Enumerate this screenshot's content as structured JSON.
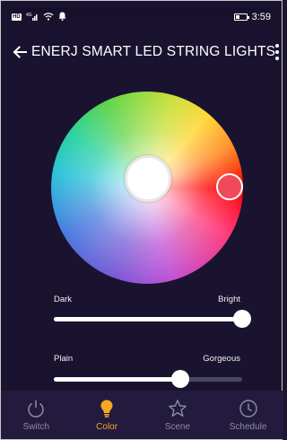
{
  "status_bar": {
    "hd_label": "HD",
    "signal_label": "4G",
    "time": "3:59",
    "battery_level_fraction": 0.35
  },
  "app_bar": {
    "title": "ENERJ SMART LED STRING LIGHTS",
    "back_icon": "arrow-left-icon",
    "menu_icon": "more-vert-icon"
  },
  "color_wheel": {
    "center_color": "#ffffff",
    "selected_color": "#ef4a5c"
  },
  "sliders": {
    "brightness": {
      "left_label": "Dark",
      "right_label": "Bright",
      "value_fraction": 1.0
    },
    "saturation": {
      "left_label": "Plain",
      "right_label": "Gorgeous",
      "value_fraction": 0.67
    }
  },
  "tabs": [
    {
      "label": "Switch",
      "icon": "power-icon",
      "active": false
    },
    {
      "label": "Color",
      "icon": "bulb-icon",
      "active": true
    },
    {
      "label": "Scene",
      "icon": "star-icon",
      "active": false
    },
    {
      "label": "Schedule",
      "icon": "clock-icon",
      "active": false
    }
  ],
  "colors": {
    "background": "#1a1330",
    "accent": "#f5a623",
    "inactive_tab": "#8f8ba2"
  }
}
